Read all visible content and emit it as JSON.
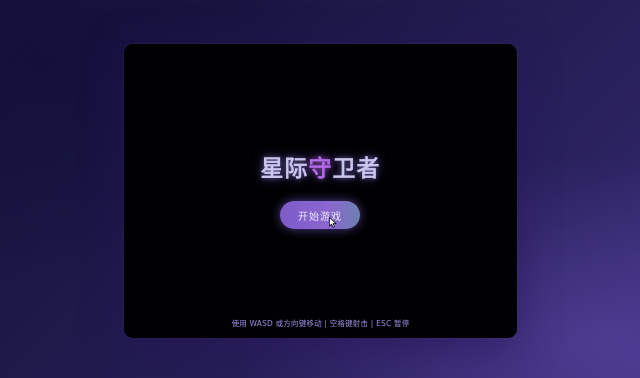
{
  "game": {
    "hud_left": "",
    "hud_right": "",
    "title_parts": [
      "星际",
      "守",
      "卫者"
    ],
    "start_button_label": "开始游戏",
    "controls_hint": "使用 WASD 或方向键移动 | 空格键射击 | ESC 暂停"
  },
  "colors": {
    "title": "#c9c6ee",
    "title_accent": "#b26ae6",
    "button_start": "#7d5cc8",
    "button_end": "#6f7fb0",
    "hint": "#9b8fe6"
  },
  "icons": {
    "cursor": "arrow-cursor-icon"
  }
}
